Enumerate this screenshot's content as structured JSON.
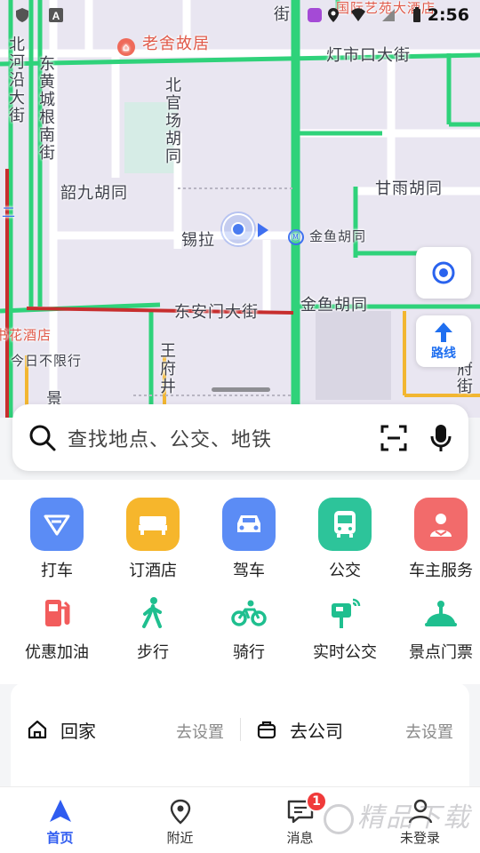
{
  "status_bar": {
    "time": "2:56"
  },
  "map": {
    "labels": {
      "beiheyan": "北河沿大街",
      "donghuangcheng": "东黄城根南街",
      "beiguanchang": "北官场胡同",
      "shaojiu": "韶九胡同",
      "xila": "锡拉",
      "jinyu_station": "金鱼胡同",
      "ganyu": "甘雨胡同",
      "dengshikou": "灯市口大街",
      "laoshe": "老舍故居",
      "guoji": "国际艺苑大酒店",
      "jie_top": "街",
      "dongan": "东安门大街",
      "jinyu_road": "金鱼胡同",
      "huajiu": "书花酒店",
      "jinri": "今日不限行",
      "wangfujing": "王府井",
      "fujie": "府街",
      "er": "二",
      "jing": "景"
    },
    "colors": {
      "road_green": "#2fd27a",
      "road_red": "#c72e2e",
      "road_yellow": "#f2b631",
      "map_bg": "#e9e6f1"
    }
  },
  "floating": {
    "locate_icon": "target-icon",
    "route_label": "路线",
    "route_icon": "arrow-up-icon"
  },
  "search": {
    "placeholder": "查找地点、公交、地铁"
  },
  "quick_row1": [
    {
      "label": "打车",
      "icon": "taxi-icon",
      "color": "#5b8cf5"
    },
    {
      "label": "订酒店",
      "icon": "bed-icon",
      "color": "#f6b62c"
    },
    {
      "label": "驾车",
      "icon": "car-icon",
      "color": "#5b8cf5"
    },
    {
      "label": "公交",
      "icon": "bus-icon",
      "color": "#2dc49a"
    },
    {
      "label": "车主服务",
      "icon": "driver-icon",
      "color": "#f26b6b"
    }
  ],
  "quick_row2": [
    {
      "label": "优惠加油",
      "icon": "gas-pump-icon"
    },
    {
      "label": "步行",
      "icon": "walk-icon"
    },
    {
      "label": "骑行",
      "icon": "bike-icon"
    },
    {
      "label": "实时公交",
      "icon": "bus-stop-icon"
    },
    {
      "label": "景点门票",
      "icon": "scenic-icon"
    }
  ],
  "addr": {
    "home": "回家",
    "home_set": "去设置",
    "company": "去公司",
    "company_set": "去设置"
  },
  "nav": [
    {
      "label": "首页",
      "icon": "home-nav-icon"
    },
    {
      "label": "附近",
      "icon": "location-pin-icon"
    },
    {
      "label": "消息",
      "icon": "message-icon",
      "badge": "1"
    },
    {
      "label": "未登录",
      "icon": "user-icon"
    }
  ],
  "watermark": "精品下载"
}
